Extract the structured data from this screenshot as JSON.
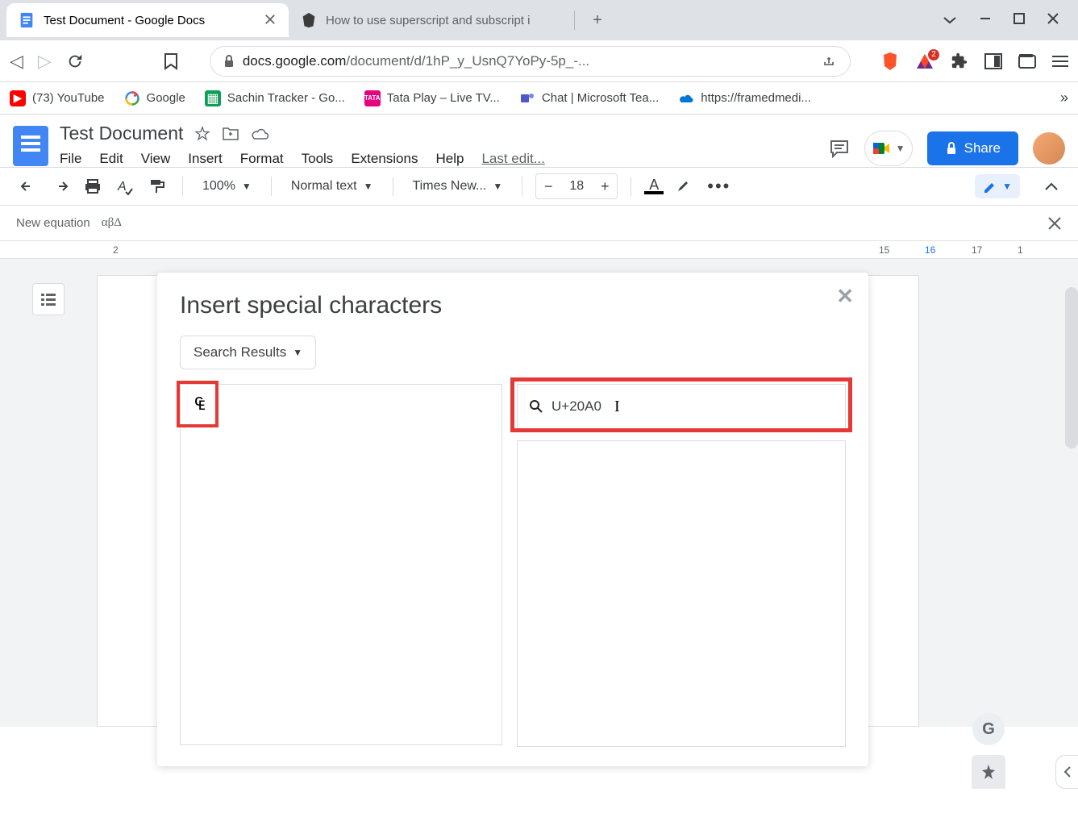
{
  "browser": {
    "tabs": [
      {
        "title": "Test Document - Google Docs",
        "active": true
      },
      {
        "title": "How to use superscript and subscript i",
        "active": false
      }
    ],
    "url_domain": "docs.google.com",
    "url_path": "/document/d/1hP_y_UsnQ7YoPy-5p_-..."
  },
  "bookmarks": [
    {
      "label": "(73) YouTube",
      "icon": "youtube"
    },
    {
      "label": "Google",
      "icon": "google"
    },
    {
      "label": "Sachin Tracker - Go...",
      "icon": "sheets"
    },
    {
      "label": "Tata Play – Live TV...",
      "icon": "tata"
    },
    {
      "label": "Chat | Microsoft Tea...",
      "icon": "teams"
    },
    {
      "label": "https://framedmedi...",
      "icon": "cloud"
    }
  ],
  "docs": {
    "title": "Test Document",
    "menus": [
      "File",
      "Edit",
      "View",
      "Insert",
      "Format",
      "Tools",
      "Extensions",
      "Help"
    ],
    "last_edit": "Last edit...",
    "share_label": "Share"
  },
  "toolbar": {
    "zoom": "100%",
    "style": "Normal text",
    "font": "Times New...",
    "font_size": "18"
  },
  "equation_bar": {
    "label": "New equation",
    "greek": "αβΔ"
  },
  "ruler": {
    "marks": [
      "2",
      "15",
      "16",
      "17",
      "1"
    ]
  },
  "dialog": {
    "title": "Insert special characters",
    "category": "Search Results",
    "result_char": "₠",
    "search_value": "U+20A0"
  }
}
